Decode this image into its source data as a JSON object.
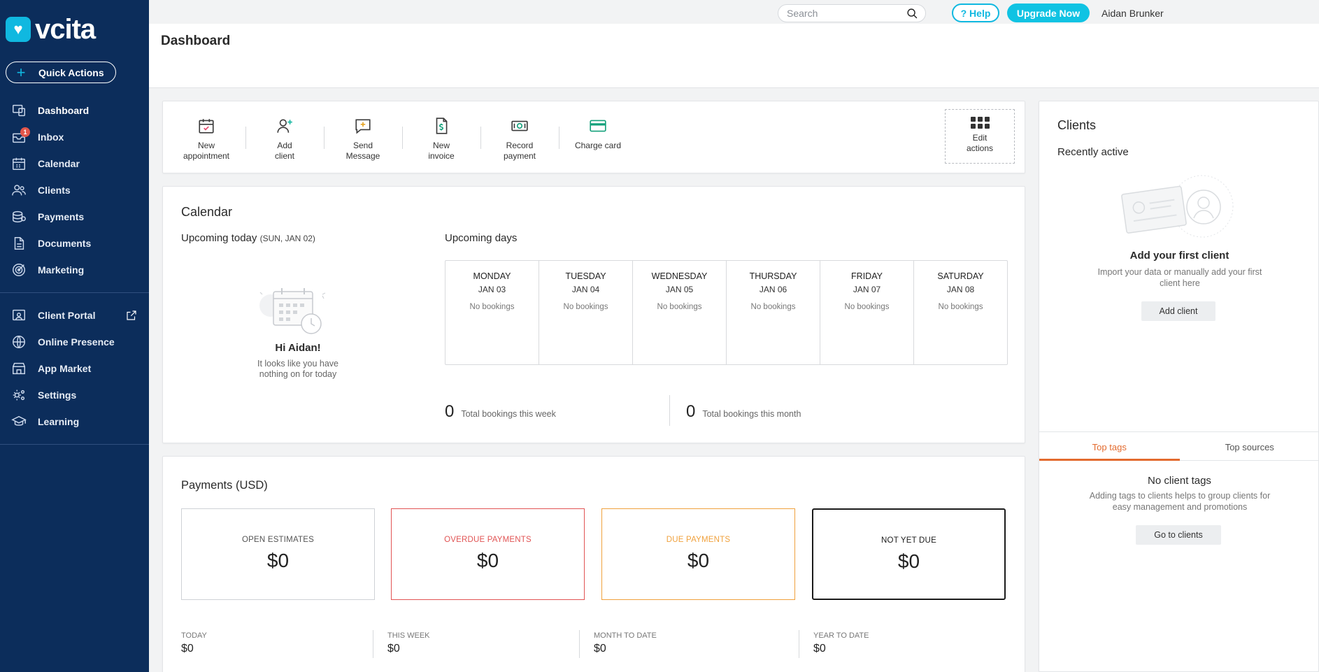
{
  "brand": {
    "name": "vcita",
    "mark": "♥",
    "accent": "#10b8e0",
    "sidebar_bg": "#0c2d5b"
  },
  "sidebar": {
    "quick_actions": "Quick Actions",
    "items": [
      {
        "label": "Dashboard",
        "icon": "dashboard-icon",
        "active": true
      },
      {
        "label": "Inbox",
        "icon": "inbox-icon",
        "badge": "1"
      },
      {
        "label": "Calendar",
        "icon": "calendar-icon"
      },
      {
        "label": "Clients",
        "icon": "clients-icon"
      },
      {
        "label": "Payments",
        "icon": "payments-icon"
      },
      {
        "label": "Documents",
        "icon": "documents-icon"
      },
      {
        "label": "Marketing",
        "icon": "marketing-icon"
      }
    ],
    "items2": [
      {
        "label": "Client Portal",
        "icon": "client-portal-icon",
        "external": true
      },
      {
        "label": "Online Presence",
        "icon": "globe-icon"
      },
      {
        "label": "App Market",
        "icon": "store-icon"
      },
      {
        "label": "Settings",
        "icon": "settings-icon"
      },
      {
        "label": "Learning",
        "icon": "graduation-cap-icon"
      }
    ]
  },
  "topbar": {
    "search_placeholder": "Search",
    "help": "? Help",
    "upgrade": "Upgrade Now",
    "user": "Aidan Brunker"
  },
  "page": {
    "title": "Dashboard"
  },
  "actions": {
    "items": [
      {
        "label1": "New",
        "label2": "appointment",
        "icon": "calendar-check-icon"
      },
      {
        "label1": "Add",
        "label2": "client",
        "icon": "add-user-icon"
      },
      {
        "label1": "Send",
        "label2": "Message",
        "icon": "message-icon"
      },
      {
        "label1": "New",
        "label2": "invoice",
        "icon": "invoice-icon"
      },
      {
        "label1": "Record",
        "label2": "payment",
        "icon": "cash-icon"
      },
      {
        "label1": "Charge card",
        "label2": "",
        "icon": "credit-card-icon"
      }
    ],
    "edit1": "Edit",
    "edit2": "actions"
  },
  "calendar": {
    "title": "Calendar",
    "upcoming_today": "Upcoming today",
    "today_date": "(SUN, JAN 02)",
    "hi": "Hi Aidan!",
    "hi_sub1": "It looks like you have",
    "hi_sub2": "nothing on for today",
    "upcoming_days": "Upcoming days",
    "days": [
      {
        "name": "MONDAY",
        "date": "JAN 03",
        "status": "No bookings"
      },
      {
        "name": "TUESDAY",
        "date": "JAN 04",
        "status": "No bookings"
      },
      {
        "name": "WEDNESDAY",
        "date": "JAN 05",
        "status": "No bookings"
      },
      {
        "name": "THURSDAY",
        "date": "JAN 06",
        "status": "No bookings"
      },
      {
        "name": "FRIDAY",
        "date": "JAN 07",
        "status": "No bookings"
      },
      {
        "name": "SATURDAY",
        "date": "JAN 08",
        "status": "No bookings"
      }
    ],
    "week_total": "0",
    "week_label": "Total bookings this week",
    "month_total": "0",
    "month_label": "Total bookings this month"
  },
  "payments": {
    "title": "Payments",
    "currency": "(USD)",
    "boxes": [
      {
        "label": "OPEN ESTIMATES",
        "value": "$0"
      },
      {
        "label": "OVERDUE PAYMENTS",
        "value": "$0"
      },
      {
        "label": "DUE PAYMENTS",
        "value": "$0"
      },
      {
        "label": "NOT YET DUE",
        "value": "$0"
      }
    ],
    "periods": [
      {
        "label": "TODAY",
        "value": "$0"
      },
      {
        "label": "THIS WEEK",
        "value": "$0"
      },
      {
        "label": "MONTH TO DATE",
        "value": "$0"
      },
      {
        "label": "YEAR TO DATE",
        "value": "$0"
      }
    ]
  },
  "clients": {
    "title": "Clients",
    "recent": "Recently active",
    "add_first": "Add your first client",
    "add_first_sub": "Import your data or manually add your first client here",
    "add_btn": "Add client",
    "tabs": [
      "Top tags",
      "Top sources"
    ],
    "no_tags": "No client tags",
    "no_tags_sub": "Adding tags to clients helps to group clients for easy management and promotions",
    "go_btn": "Go to clients"
  }
}
